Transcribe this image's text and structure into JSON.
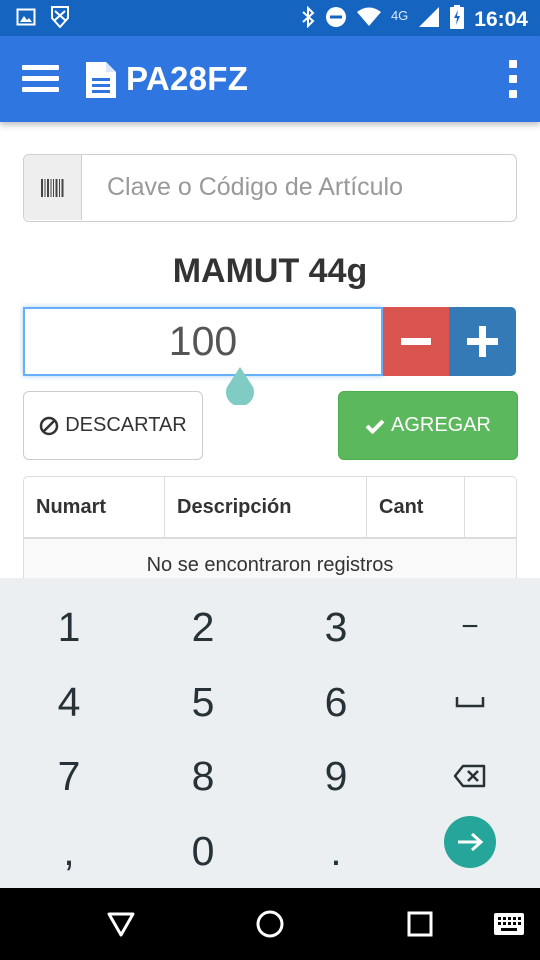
{
  "status_bar": {
    "network": "4G",
    "time": "16:04"
  },
  "app_bar": {
    "title": "PA28FZ"
  },
  "search": {
    "placeholder": "Clave o Código de Artículo"
  },
  "product": {
    "name": "MAMUT 44g"
  },
  "quantity": {
    "value": "100"
  },
  "actions": {
    "discard_label": "DESCARTAR",
    "add_label": "AGREGAR"
  },
  "table": {
    "columns": [
      "Numart",
      "Descripción",
      "Cant",
      ""
    ],
    "empty_message": "No se encontraron registros"
  },
  "keyboard": {
    "keys": [
      "1",
      "2",
      "3",
      "−",
      "4",
      "5",
      "6",
      "⎵",
      "7",
      "8",
      "9",
      "⌫",
      ",",
      "0",
      ".",
      "→"
    ]
  },
  "colors": {
    "status_bar": "#1565c0",
    "app_bar": "#2f76e0",
    "danger": "#d9534f",
    "primary": "#337ab7",
    "success": "#5cb85c",
    "keyboard_bg": "#eceff1",
    "go_key": "#26a69a"
  }
}
